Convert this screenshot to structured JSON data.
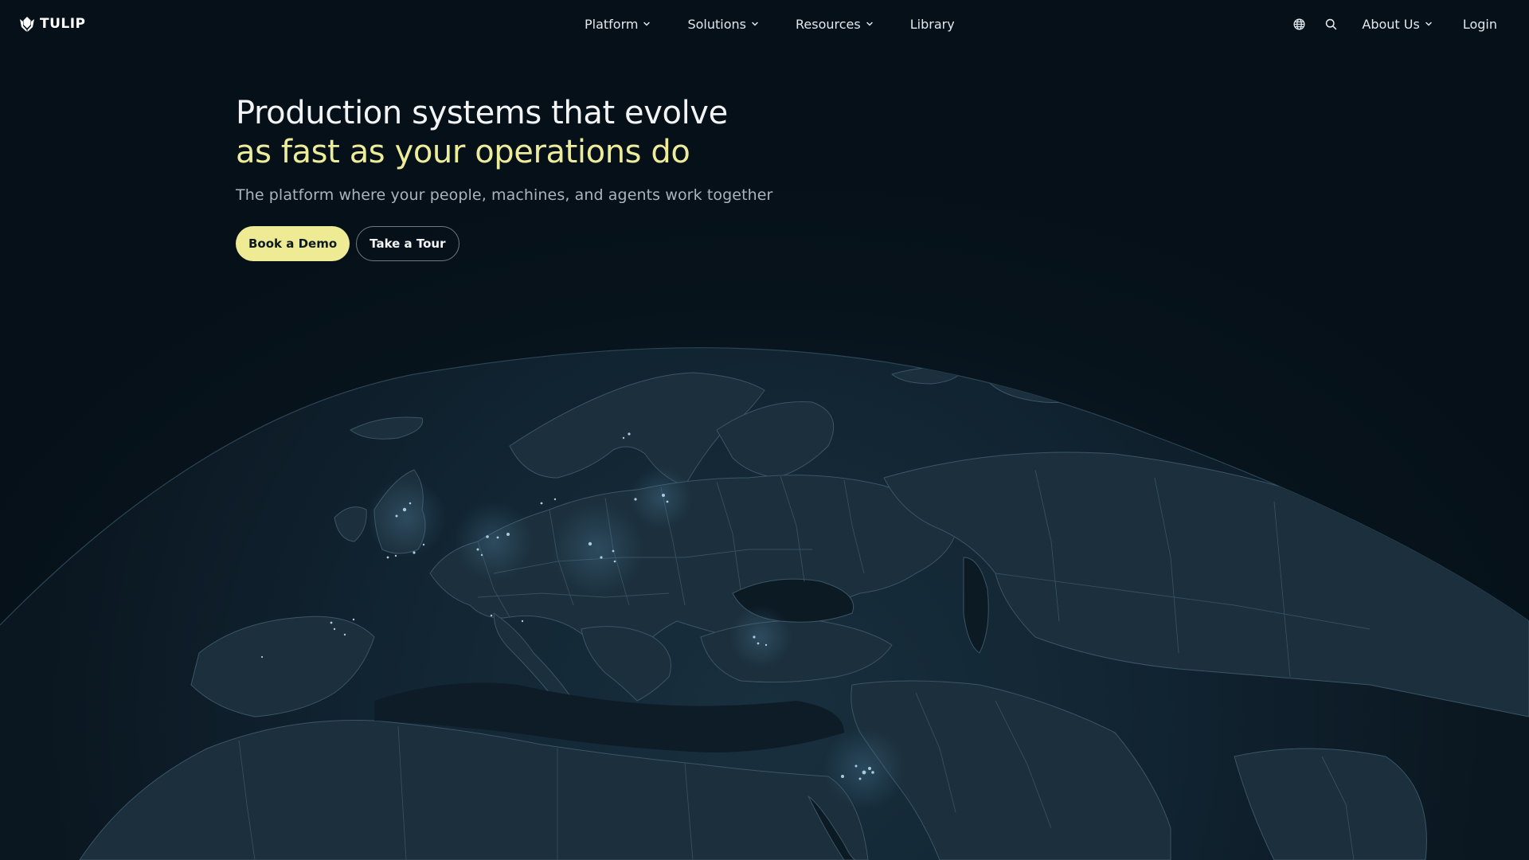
{
  "brand": {
    "name": "TULIP"
  },
  "nav": {
    "items": [
      {
        "label": "Platform",
        "has_dropdown": true
      },
      {
        "label": "Solutions",
        "has_dropdown": true
      },
      {
        "label": "Resources",
        "has_dropdown": true
      },
      {
        "label": "Library",
        "has_dropdown": false
      }
    ],
    "right": {
      "language_icon": "globe-icon",
      "search_icon": "search-icon",
      "about": {
        "label": "About Us",
        "has_dropdown": true
      },
      "login": "Login"
    }
  },
  "hero": {
    "headline_line1": "Production systems that evolve",
    "headline_line2": "as fast as your operations do",
    "subheadline": "The platform where your people, machines, and agents work together",
    "cta_primary": "Book a Demo",
    "cta_secondary": "Take a Tour"
  },
  "colors": {
    "background": "#07141c",
    "accent": "#efea94",
    "headline_accent": "#ecec9a",
    "globe_land": "#1a2c39",
    "globe_border": "#3c5666",
    "city_light": "#9fc4dc"
  }
}
